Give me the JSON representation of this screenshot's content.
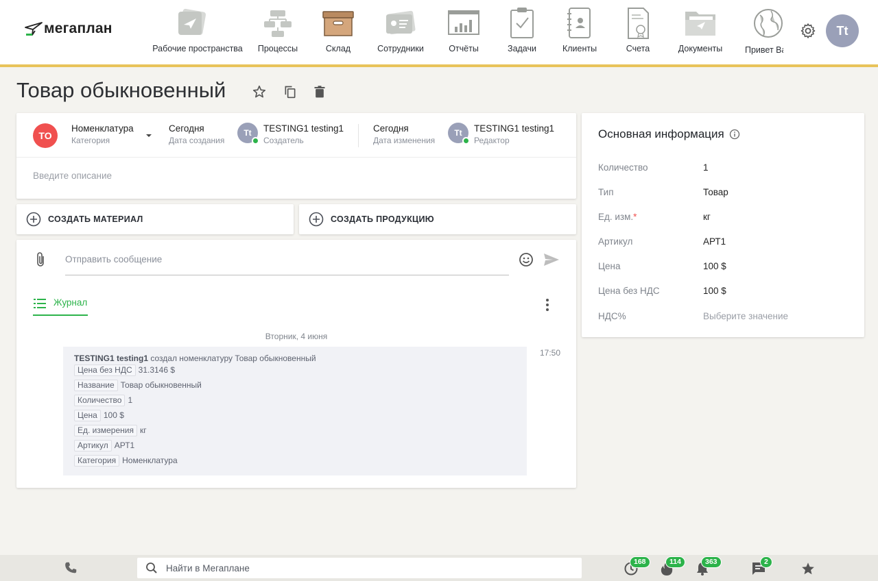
{
  "app": {
    "logo_text": "мегаплан"
  },
  "nav": {
    "items": [
      {
        "label": "Рабочие пространства",
        "icon": "workspaces-icon"
      },
      {
        "label": "Процессы",
        "icon": "processes-icon"
      },
      {
        "label": "Склад",
        "icon": "warehouse-icon",
        "active": true
      },
      {
        "label": "Сотрудники",
        "icon": "employees-icon"
      },
      {
        "label": "Отчёты",
        "icon": "reports-icon"
      },
      {
        "label": "Задачи",
        "icon": "tasks-icon"
      },
      {
        "label": "Клиенты",
        "icon": "clients-icon"
      },
      {
        "label": "Счета",
        "icon": "invoices-icon"
      },
      {
        "label": "Документы",
        "icon": "documents-icon"
      },
      {
        "label": "Привет Ва",
        "icon": "globe-icon"
      }
    ],
    "user_initials": "Tt"
  },
  "page": {
    "title": "Товар обыкновенный"
  },
  "header": {
    "badge": "TO",
    "category_value": "Номенклатура",
    "category_label": "Категория",
    "created_value": "Сегодня",
    "created_label": "Дата создания",
    "creator_initials": "Tt",
    "creator_value": "TESTING1 testing1",
    "creator_label": "Создатель",
    "modified_value": "Сегодня",
    "modified_label": "Дата изменения",
    "editor_initials": "Tt",
    "editor_value": "TESTING1 testing1",
    "editor_label": "Редактор",
    "description_placeholder": "Введите описание"
  },
  "actions": {
    "create_material": "СОЗДАТЬ МАТЕРИАЛ",
    "create_product": "СОЗДАТЬ ПРОДУКЦИЮ"
  },
  "chat": {
    "message_placeholder": "Отправить сообщение",
    "journal_tab": "Журнал",
    "date": "Вторник, 4 июня",
    "time": "17:50",
    "entry": {
      "author": "TESTING1 testing1",
      "action": "создал  номенклатуру Товар обыкновенный",
      "fields": [
        {
          "key": "Цена без НДС",
          "value": "31.3146 $"
        },
        {
          "key": "Название",
          "value": "Товар обыкновенный"
        },
        {
          "key": "Количество",
          "value": "1"
        },
        {
          "key": "Цена",
          "value": "100 $"
        },
        {
          "key": "Ед. измерения",
          "value": "кг"
        },
        {
          "key": "Артикул",
          "value": "АРТ1"
        },
        {
          "key": "Категория",
          "value": "Номенклатура"
        }
      ]
    }
  },
  "info": {
    "title": "Основная информация",
    "rows": [
      {
        "key": "Количество",
        "value": "1"
      },
      {
        "key": "Тип",
        "value": "Товар"
      },
      {
        "key": "Ед. изм.",
        "value": "кг",
        "required": "*"
      },
      {
        "key": "Артикул",
        "value": "АРТ1"
      },
      {
        "key": "Цена",
        "value": "100 $"
      },
      {
        "key": "Цена без НДС",
        "value": "100 $"
      },
      {
        "key": "НДС%",
        "value": "Выберите значение"
      }
    ]
  },
  "bottombar": {
    "search_placeholder": "Найти в Мегаплане",
    "badges": {
      "activity": "168",
      "hot": "114",
      "notifications": "363",
      "messages": "2"
    }
  },
  "colors": {
    "accent_green": "#2cb34a",
    "accent_yellow": "#e8c35a",
    "badge_red": "#f0504f"
  }
}
